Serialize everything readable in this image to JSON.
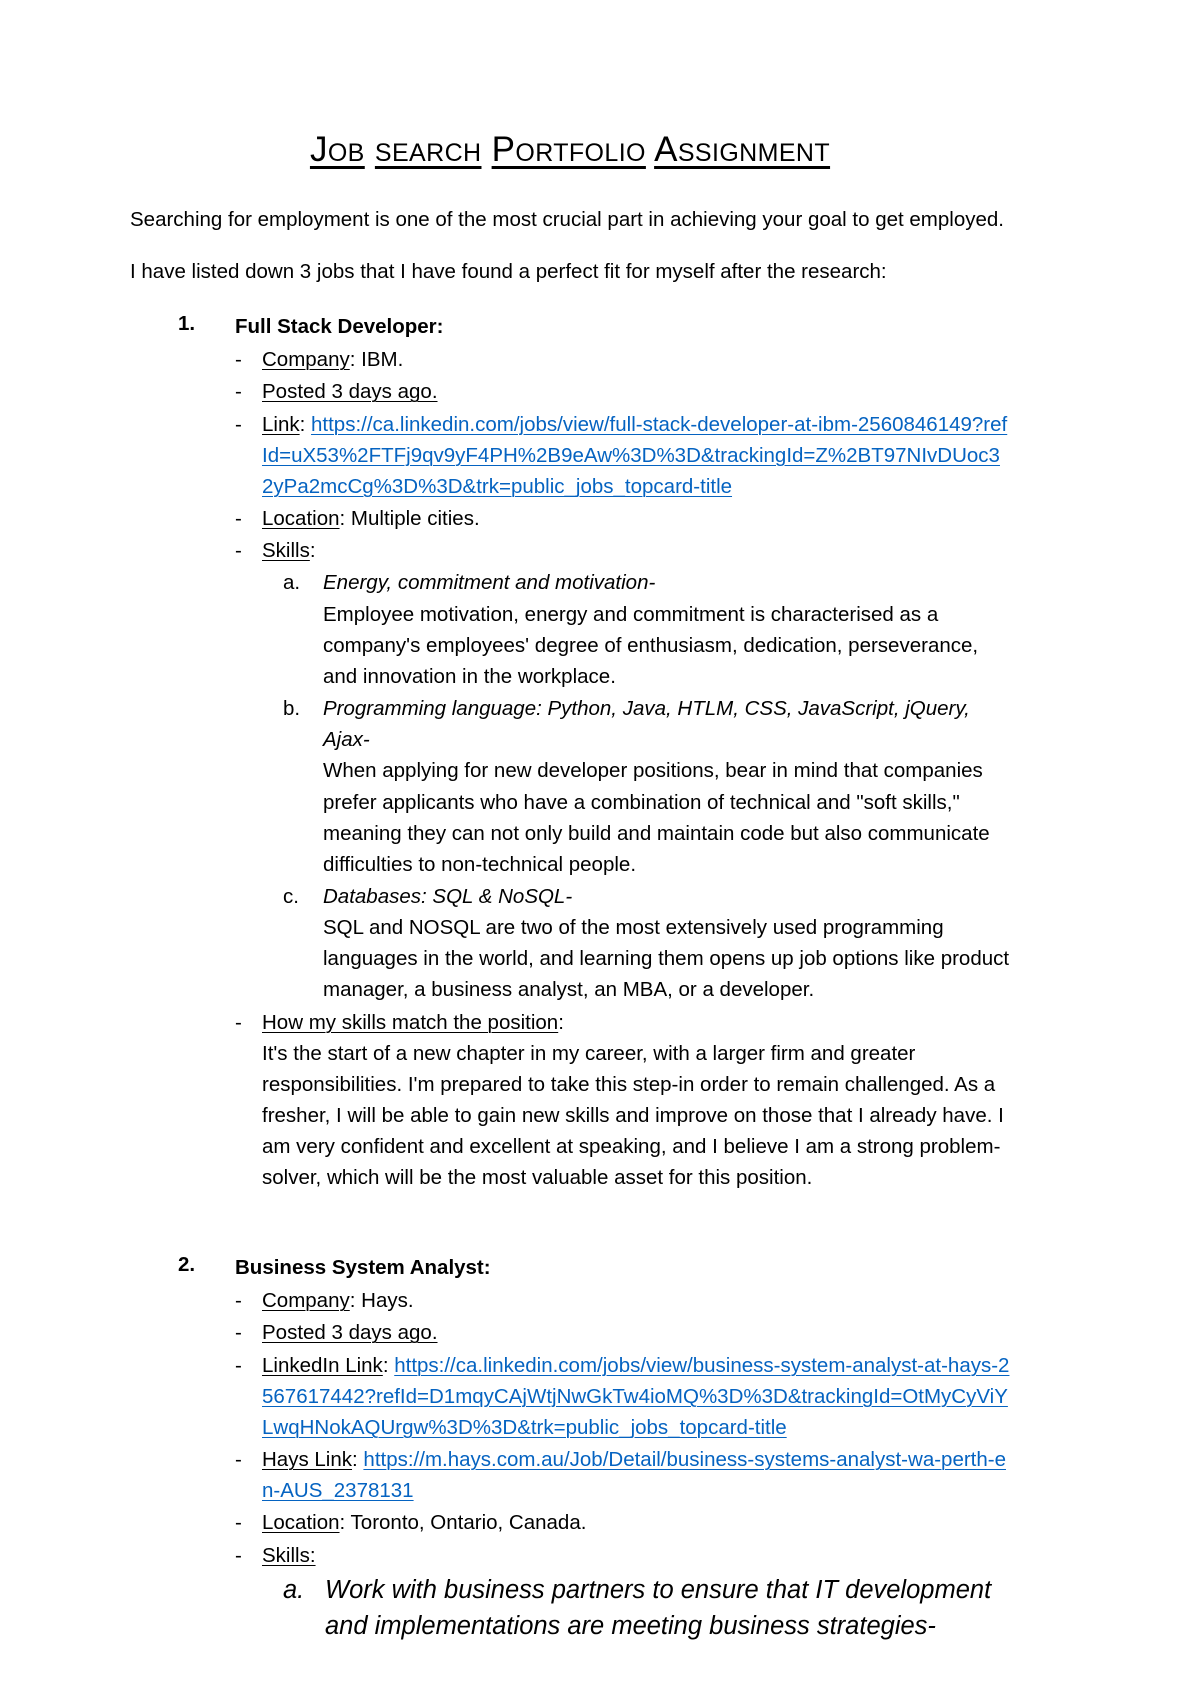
{
  "document": {
    "title_words": [
      "Job",
      "search",
      "Portfolio",
      "Assignment"
    ],
    "title_full": "JOB SEARCH PORTFOLIO ASSIGNMENT",
    "intro_paragraph": "Searching for employment is one of the most crucial part in achieving your goal to get employed.",
    "lead_paragraph": "I have listed down 3 jobs that I have found a perfect fit for myself after the research:"
  },
  "jobs": [
    {
      "number": "1.",
      "title": "Full Stack Developer:",
      "company_label": "Company",
      "company_value": ": IBM.",
      "posted": "Posted 3 days ago.",
      "link_label": "Link",
      "link_sep": ":  ",
      "link_url": "https://ca.linkedin.com/jobs/view/full-stack-developer-at-ibm-2560846149?refId=uX53%2FTFj9qv9yF4PH%2B9eAw%3D%3D&trackingId=Z%2BT97NIvDUoc32yPa2mcCg%3D%3D&trk=public_jobs_topcard-title",
      "location_label": "Location",
      "location_value": ": Multiple cities.",
      "skills_label": "Skills",
      "skills_colon": ":",
      "skills": [
        {
          "letter": "a.",
          "head": "Energy, commitment and motivation-",
          "desc": "Employee motivation, energy and commitment is characterised as a company's employees' degree of enthusiasm, dedication, perseverance, and innovation in the workplace."
        },
        {
          "letter": "b.",
          "head": "Programming language: Python, Java, HTLM, CSS, JavaScript, jQuery, Ajax-",
          "desc": "When applying for new developer positions, bear in mind that companies prefer applicants who have a combination of technical and \"soft skills,\" meaning they can not only build and maintain code but also communicate difficulties to non-technical people."
        },
        {
          "letter": "c.",
          "head": "Databases: SQL & NoSQL-",
          "desc": "SQL and NOSQL are two of the most extensively used programming languages in the world, and learning them opens up job options like product manager, a business analyst, an MBA, or a developer."
        }
      ],
      "match_label": "How my skills match the position",
      "match_colon": ":",
      "match_text": "It's the start of a new chapter in my career, with a larger firm and greater responsibilities. I'm prepared to take this step-in order to remain challenged. As a fresher, I will be able to gain new skills and improve on those that I already have. I am very confident and excellent at speaking, and I believe I am a strong problem-solver, which will be the most valuable asset for this position."
    },
    {
      "number": "2.",
      "title": "Business System Analyst:",
      "company_label": "Company",
      "company_value": ": Hays.",
      "posted": "Posted 3 days ago.",
      "linkedin_label": "LinkedIn Link",
      "linkedin_sep": ": ",
      "linkedin_url": "https://ca.linkedin.com/jobs/view/business-system-analyst-at-hays-2567617442?refId=D1mqyCAjWtjNwGkTw4ioMQ%3D%3D&trackingId=OtMyCyViYLwqHNokAQUrgw%3D%3D&trk=public_jobs_topcard-title",
      "hays_label": "Hays Link",
      "hays_sep": ": ",
      "hays_url": "https://m.hays.com.au/Job/Detail/business-systems-analyst-wa-perth-en-AUS_2378131",
      "location_label": "Location",
      "location_value": ": Toronto, Ontario, Canada.",
      "skills_label": "Skills:",
      "skills": [
        {
          "letter": "a.",
          "head": "Work with business partners to ensure that IT development and implementations are meeting business strategies-"
        }
      ]
    }
  ],
  "colors": {
    "hyperlink": "#0563C1",
    "text": "#000000",
    "page_background": "#ffffff"
  }
}
